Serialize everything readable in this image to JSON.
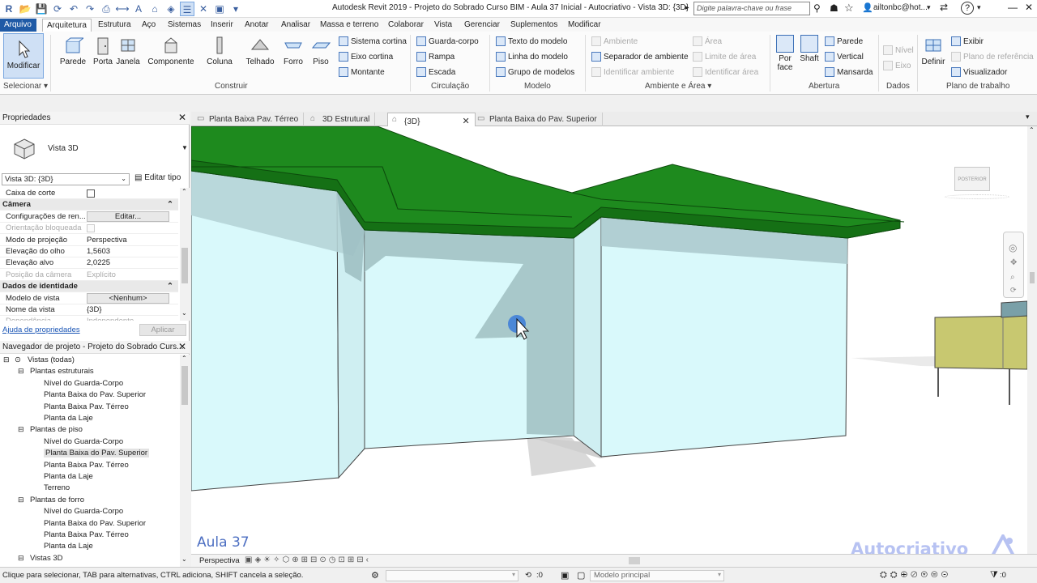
{
  "app": {
    "title": "Autodesk Revit 2019 - Projeto do Sobrado Curso BIM - Aula 37 Inicial - Autocriativo - Vista 3D: {3D}",
    "search_placeholder": "Digite palavra-chave ou frase",
    "user": "ailtonbc@hot...",
    "help": "?"
  },
  "ribbon_tabs": [
    "Arquivo",
    "Arquitetura",
    "Estrutura",
    "Aço",
    "Sistemas",
    "Inserir",
    "Anotar",
    "Analisar",
    "Massa e terreno",
    "Colaborar",
    "Vista",
    "Gerenciar",
    "Suplementos",
    "Modificar"
  ],
  "ribbon": {
    "select": {
      "modify": "Modificar",
      "select_label": "Selecionar ▾"
    },
    "build": {
      "label": "Construir",
      "big": [
        "Parede",
        "Porta",
        "Janela",
        "Componente",
        "Coluna",
        "Telhado",
        "Forro",
        "Piso"
      ],
      "small": [
        "Sistema  cortina",
        "Eixo  cortina",
        "Montante"
      ]
    },
    "circulation": {
      "label": "Circulação",
      "items": [
        "Guarda-corpo",
        "Rampa",
        "Escada"
      ]
    },
    "model": {
      "label": "Modelo",
      "items": [
        "Texto do  modelo",
        "Linha do  modelo",
        "Grupo de modelos"
      ]
    },
    "room": {
      "label": "Ambiente e Área ▾",
      "items": [
        "Ambiente",
        "Separador de ambiente",
        "Identificar  ambiente",
        "Área",
        "Limite de área",
        "Identificar área"
      ]
    },
    "opening": {
      "label": "Abertura",
      "big": [
        "Por face",
        "Shaft"
      ],
      "small": [
        "Parede",
        "Vertical",
        "Mansarda"
      ]
    },
    "datum": {
      "label": "Dados",
      "items": [
        "Nível",
        "Eixo"
      ]
    },
    "workplane": {
      "label": "Plano de trabalho",
      "big": "Definir",
      "items": [
        "Exibir",
        "Plano de referência",
        "Visualizador"
      ]
    }
  },
  "properties": {
    "header": "Propriedades",
    "type_name": "Vista 3D",
    "selector": "Vista 3D: {3D}",
    "edit_type": "Editar tipo",
    "rows": [
      {
        "k": "Caixa de corte",
        "v": "",
        "kind": "check"
      },
      {
        "k": "Câmera",
        "v": "",
        "kind": "cat"
      },
      {
        "k": "Configurações de ren...",
        "v": "Editar...",
        "kind": "button"
      },
      {
        "k": "Orientação bloqueada",
        "v": "",
        "kind": "dis"
      },
      {
        "k": "Modo de projeção",
        "v": "Perspectiva",
        "kind": "val"
      },
      {
        "k": "Elevação do olho",
        "v": "1,5603",
        "kind": "val"
      },
      {
        "k": "Elevação alvo",
        "v": "2,0225",
        "kind": "val"
      },
      {
        "k": "Posição da câmera",
        "v": "Explícito",
        "kind": "dis"
      },
      {
        "k": "Dados de identidade",
        "v": "",
        "kind": "cat"
      },
      {
        "k": "Modelo de vista",
        "v": "<Nenhum>",
        "kind": "button"
      },
      {
        "k": "Nome da vista",
        "v": "{3D}",
        "kind": "val"
      },
      {
        "k": "Dependência",
        "v": "Independente",
        "kind": "dis"
      }
    ],
    "help_link": "Ajuda de propriedades",
    "apply": "Aplicar"
  },
  "browser": {
    "header": "Navegador de projeto - Projeto do Sobrado Curs...",
    "items": [
      {
        "t": "Vistas (todas)",
        "lvl": 0
      },
      {
        "t": "Plantas estruturais",
        "lvl": 1
      },
      {
        "t": "Nível do Guarda-Corpo",
        "lvl": 2
      },
      {
        "t": "Planta Baixa do Pav. Superior",
        "lvl": 2
      },
      {
        "t": "Planta Baixa Pav. Térreo",
        "lvl": 2
      },
      {
        "t": "Planta da Laje",
        "lvl": 2
      },
      {
        "t": "Plantas de piso",
        "lvl": 1
      },
      {
        "t": "Nível do Guarda-Corpo",
        "lvl": 2
      },
      {
        "t": "Planta Baixa do Pav. Superior",
        "lvl": 2,
        "sel": true
      },
      {
        "t": "Planta Baixa Pav. Térreo",
        "lvl": 2
      },
      {
        "t": "Planta da Laje",
        "lvl": 2
      },
      {
        "t": "Terreno",
        "lvl": 2
      },
      {
        "t": "Plantas de forro",
        "lvl": 1
      },
      {
        "t": "Nível do Guarda-Corpo",
        "lvl": 2
      },
      {
        "t": "Planta Baixa do Pav. Superior",
        "lvl": 2
      },
      {
        "t": "Planta Baixa Pav. Térreo",
        "lvl": 2
      },
      {
        "t": "Planta da Laje",
        "lvl": 2
      },
      {
        "t": "Vistas 3D",
        "lvl": 1
      }
    ]
  },
  "view_tabs": [
    "Planta Baixa Pav. Térreo",
    "3D Estrutural",
    "{3D}",
    "Planta Baixa do Pav. Superior"
  ],
  "viewcube": "POSTERIOR",
  "overlay": {
    "lesson": "Aula 37",
    "brand": "Autocriativo"
  },
  "viewbar": {
    "mode": "Perspectiva"
  },
  "status": {
    "hint": "Clique para selecionar, TAB para alternativas, CTRL adiciona, SHIFT cancela a seleção.",
    "counter": ":0",
    "model": "Modelo principal",
    "filter": ":0"
  },
  "colors": {
    "roof": "#1e8a1e",
    "wall": "#d9f9fb",
    "accent": "#1f5aa6",
    "rail": "#c8c870"
  }
}
